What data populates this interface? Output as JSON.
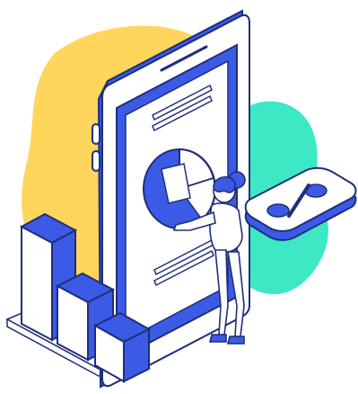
{
  "colors": {
    "yellow_blob": "#FFD55C",
    "mint_blob": "#3DE8C4",
    "blue": "#3B5BE6",
    "outline": "#1F2E7A",
    "white": "#FFFFFF"
  },
  "badge": {
    "symbol": "%"
  }
}
